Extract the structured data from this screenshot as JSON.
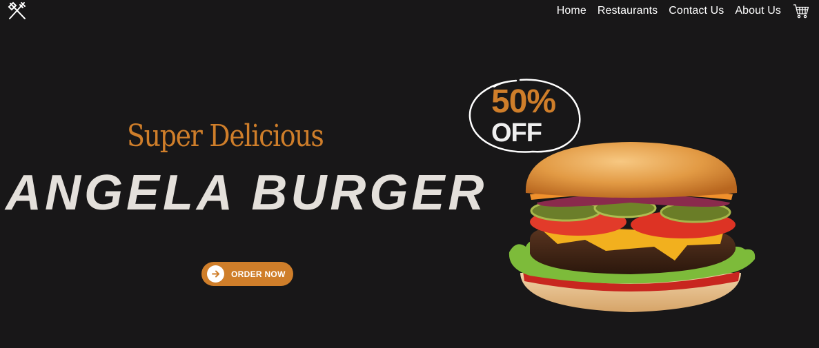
{
  "header": {
    "logo_icon": "fork-knife-icon",
    "nav": [
      {
        "label": "Home"
      },
      {
        "label": "Restaurants"
      },
      {
        "label": "Contact Us"
      },
      {
        "label": "About Us"
      }
    ],
    "cart_icon": "shopping-cart-icon"
  },
  "hero": {
    "tagline": "Super Delicious",
    "title": "ANGELA BURGER",
    "cta": {
      "label": "ORDER NOW",
      "icon": "arrow-right-icon"
    },
    "badge": {
      "amount": "50%",
      "text": "OFF"
    }
  },
  "colors": {
    "background": "#181718",
    "accent": "#cf7e2a",
    "title": "#e4e0db",
    "text": "#ffffff"
  }
}
